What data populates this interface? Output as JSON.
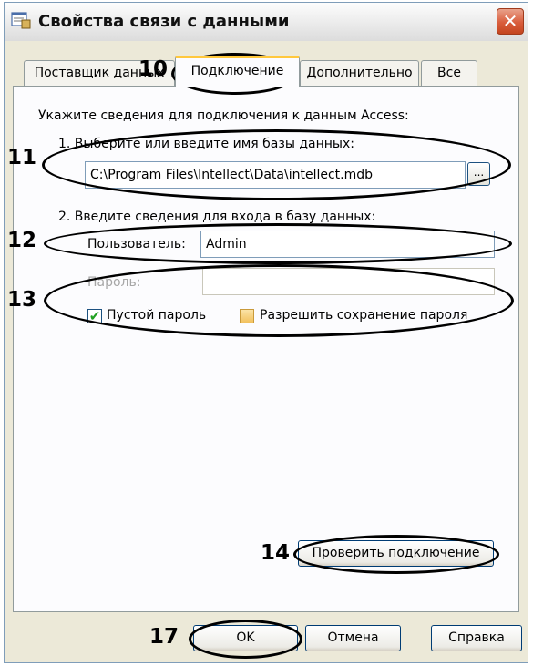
{
  "window": {
    "title": "Свойства связи с данными",
    "close_symbol": "✕"
  },
  "tabs": [
    {
      "label": "Поставщик данных"
    },
    {
      "label": "Подключение"
    },
    {
      "label": "Дополнительно"
    },
    {
      "label": "Все"
    }
  ],
  "connection": {
    "intro": "Укажите сведения для подключения к данным Access:",
    "step1_label": "1. Выберите или введите имя базы данных:",
    "db_path": "C:\\Program Files\\Intellect\\Data\\intellect.mdb",
    "browse_label": "...",
    "step2_label": "2. Введите сведения для входа в базу данных:",
    "user_label": "Пользователь:",
    "user_value": "Admin",
    "password_label": "Пароль:",
    "password_value": "",
    "blank_password_label": "Пустой пароль",
    "blank_password_checked": true,
    "allow_save_label": "Разрешить сохранение пароля",
    "allow_save_checked": false,
    "test_button": "Проверить подключение"
  },
  "footer": {
    "ok": "OK",
    "cancel": "Отмена",
    "help": "Справка"
  },
  "callouts": {
    "n10": "10",
    "n11": "11",
    "n12": "12",
    "n13": "13",
    "n14": "14",
    "n17": "17"
  },
  "icons": {
    "app": "data-link-icon",
    "close": "close-icon",
    "check": "check-icon"
  }
}
